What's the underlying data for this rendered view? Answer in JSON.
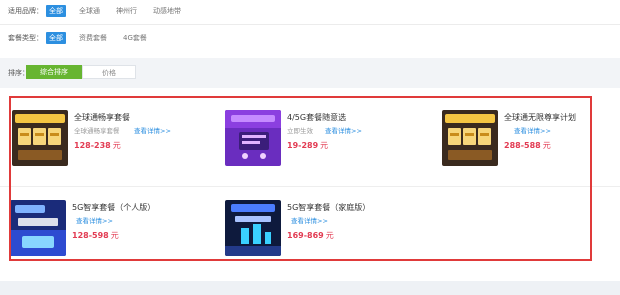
{
  "filters": {
    "brand": {
      "label": "适用品牌：",
      "options": [
        "全部",
        "全球通",
        "神州行",
        "动感地带"
      ],
      "selected": 0
    },
    "package_type": {
      "label": "套餐类型：",
      "options": [
        "全部",
        "资费套餐",
        "4G套餐"
      ],
      "selected": 0
    }
  },
  "sort": {
    "label": "排序：",
    "options": [
      "综合排序",
      "价格"
    ],
    "selected": 0
  },
  "cards": [
    {
      "title": "全球通畅享套餐",
      "subtitle": "全球通畅享套餐",
      "link": "查看详情>>",
      "price": "128-238",
      "unit": "元",
      "thumb": "gold-tickets"
    },
    {
      "title": "4/5G套餐随意选",
      "subtitle": "立即生效",
      "link": "查看详情>>",
      "price": "19-289",
      "unit": "元",
      "thumb": "purple-cart"
    },
    {
      "title": "全球通无限尊享计划",
      "subtitle": "",
      "link": "查看详情>>",
      "price": "288-588",
      "unit": "元",
      "thumb": "gold-tickets"
    },
    {
      "title": "5G智享套餐（个人版）",
      "subtitle": "",
      "link": "查看详情>>",
      "price": "128-598",
      "unit": "元",
      "thumb": "blue-5g"
    },
    {
      "title": "5G智享套餐（家庭版）",
      "subtitle": "",
      "link": "查看详情>>",
      "price": "169-869",
      "unit": "元",
      "thumb": "dark-5g-family"
    }
  ],
  "colors": {
    "accent_blue": "#2c8fe0",
    "accent_green": "#67b531",
    "price_red": "#e23b52",
    "highlight_red": "#e03a3a"
  }
}
